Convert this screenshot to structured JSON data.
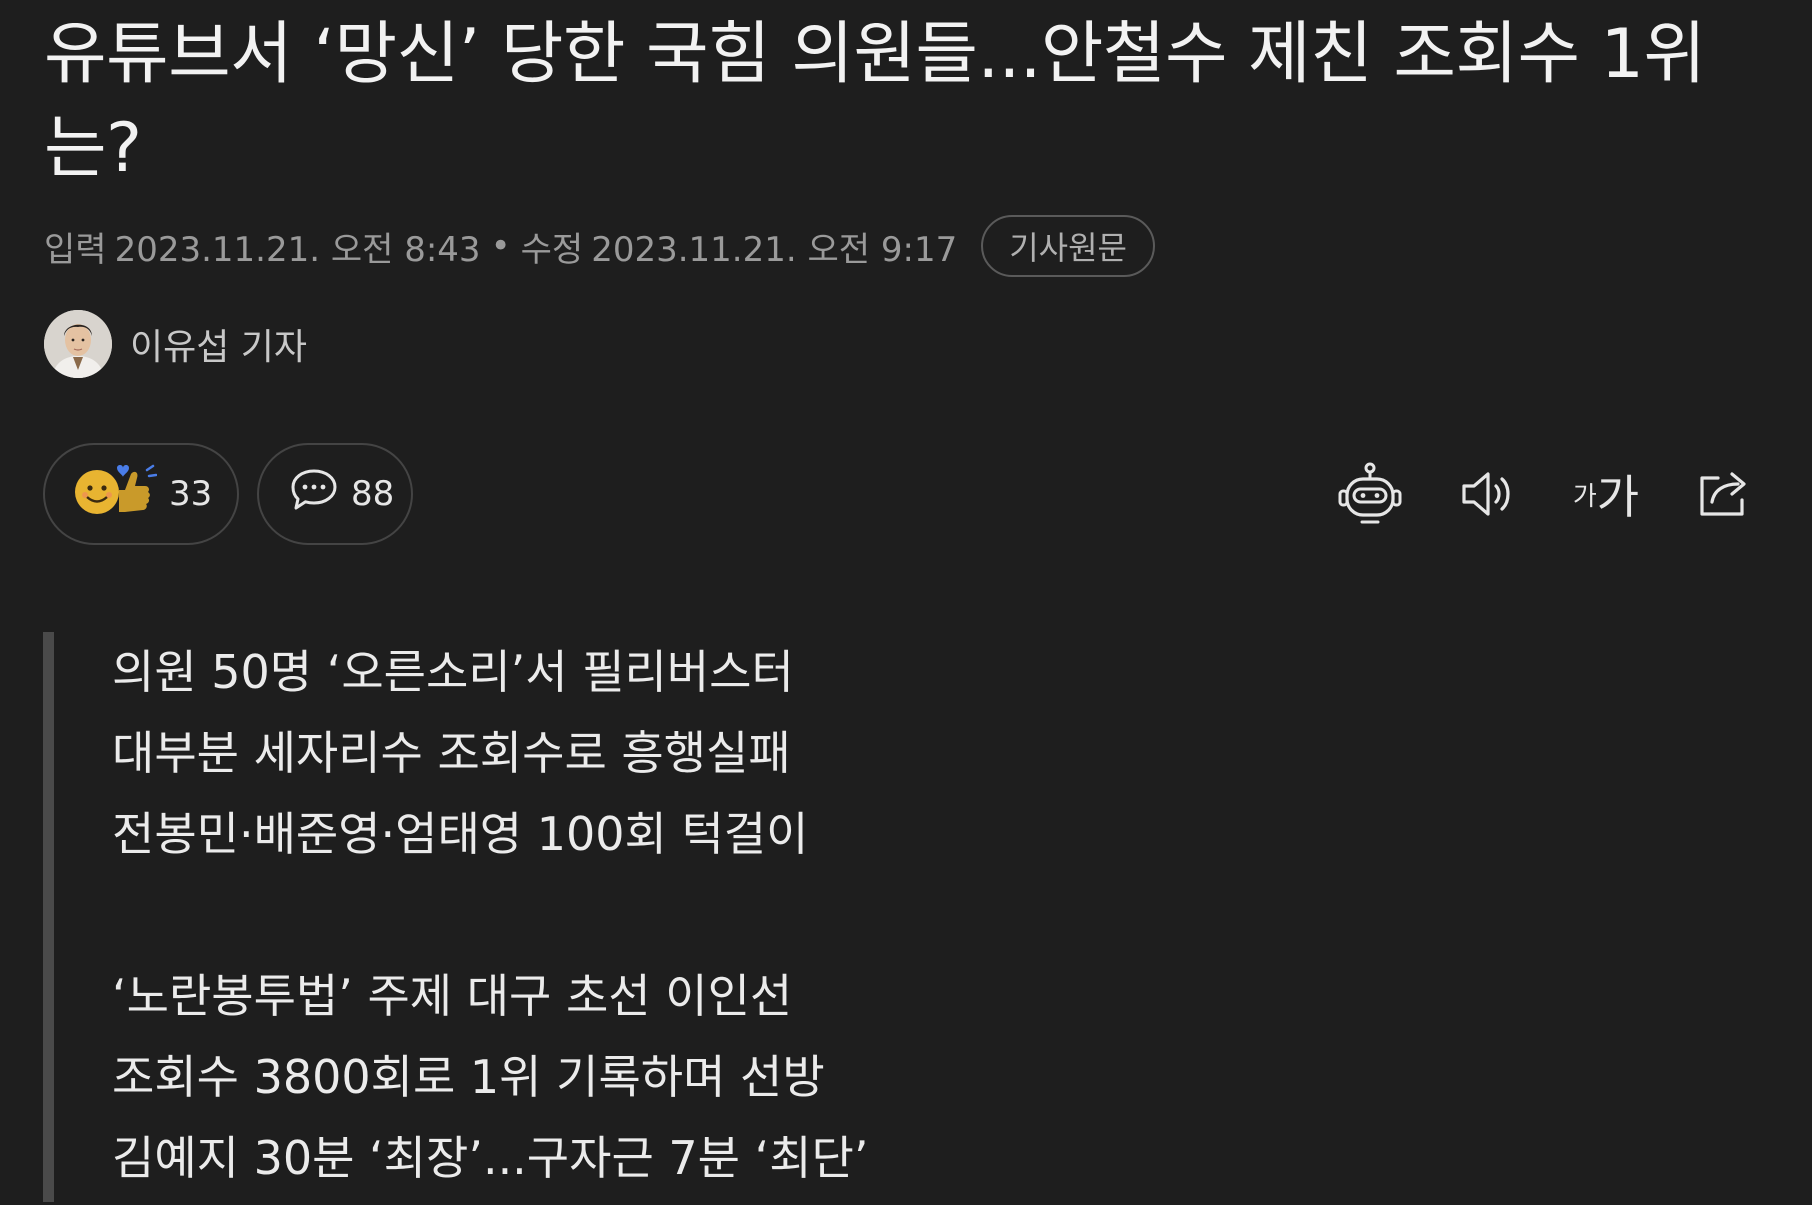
{
  "article": {
    "headline": "유튜브서 ‘망신’ 당한 국힘 의원들...안철수 제친 조회수 1위는?",
    "meta": {
      "input_label": "입력",
      "input_time": "2023.11.21. 오전 8:43",
      "separator": "•",
      "modified_label": "수정",
      "modified_time": "2023.11.21. 오전 9:17",
      "original_button": "기사원문"
    },
    "author": {
      "name": "이유섭 기자"
    },
    "reactions": {
      "like_count": "33",
      "comment_count": "88"
    },
    "tools": {
      "font_small": "가",
      "font_large": "가",
      "icons": [
        "robot-icon",
        "speaker-icon",
        "font-size-icon",
        "share-icon"
      ]
    },
    "summary": {
      "lines": [
        "의원 50명 ‘오른소리’서 필리버스터",
        "대부분 세자리수 조회수로 흥행실패",
        "전봉민·배준영·엄태영 100회 턱걸이",
        "‘노란봉투법’ 주제 대구 초선 이인선",
        "조회수 3800회로 1위 기록하며 선방",
        "김예지 30분 ‘최장’...구자근 7분 ‘최단’"
      ]
    }
  }
}
